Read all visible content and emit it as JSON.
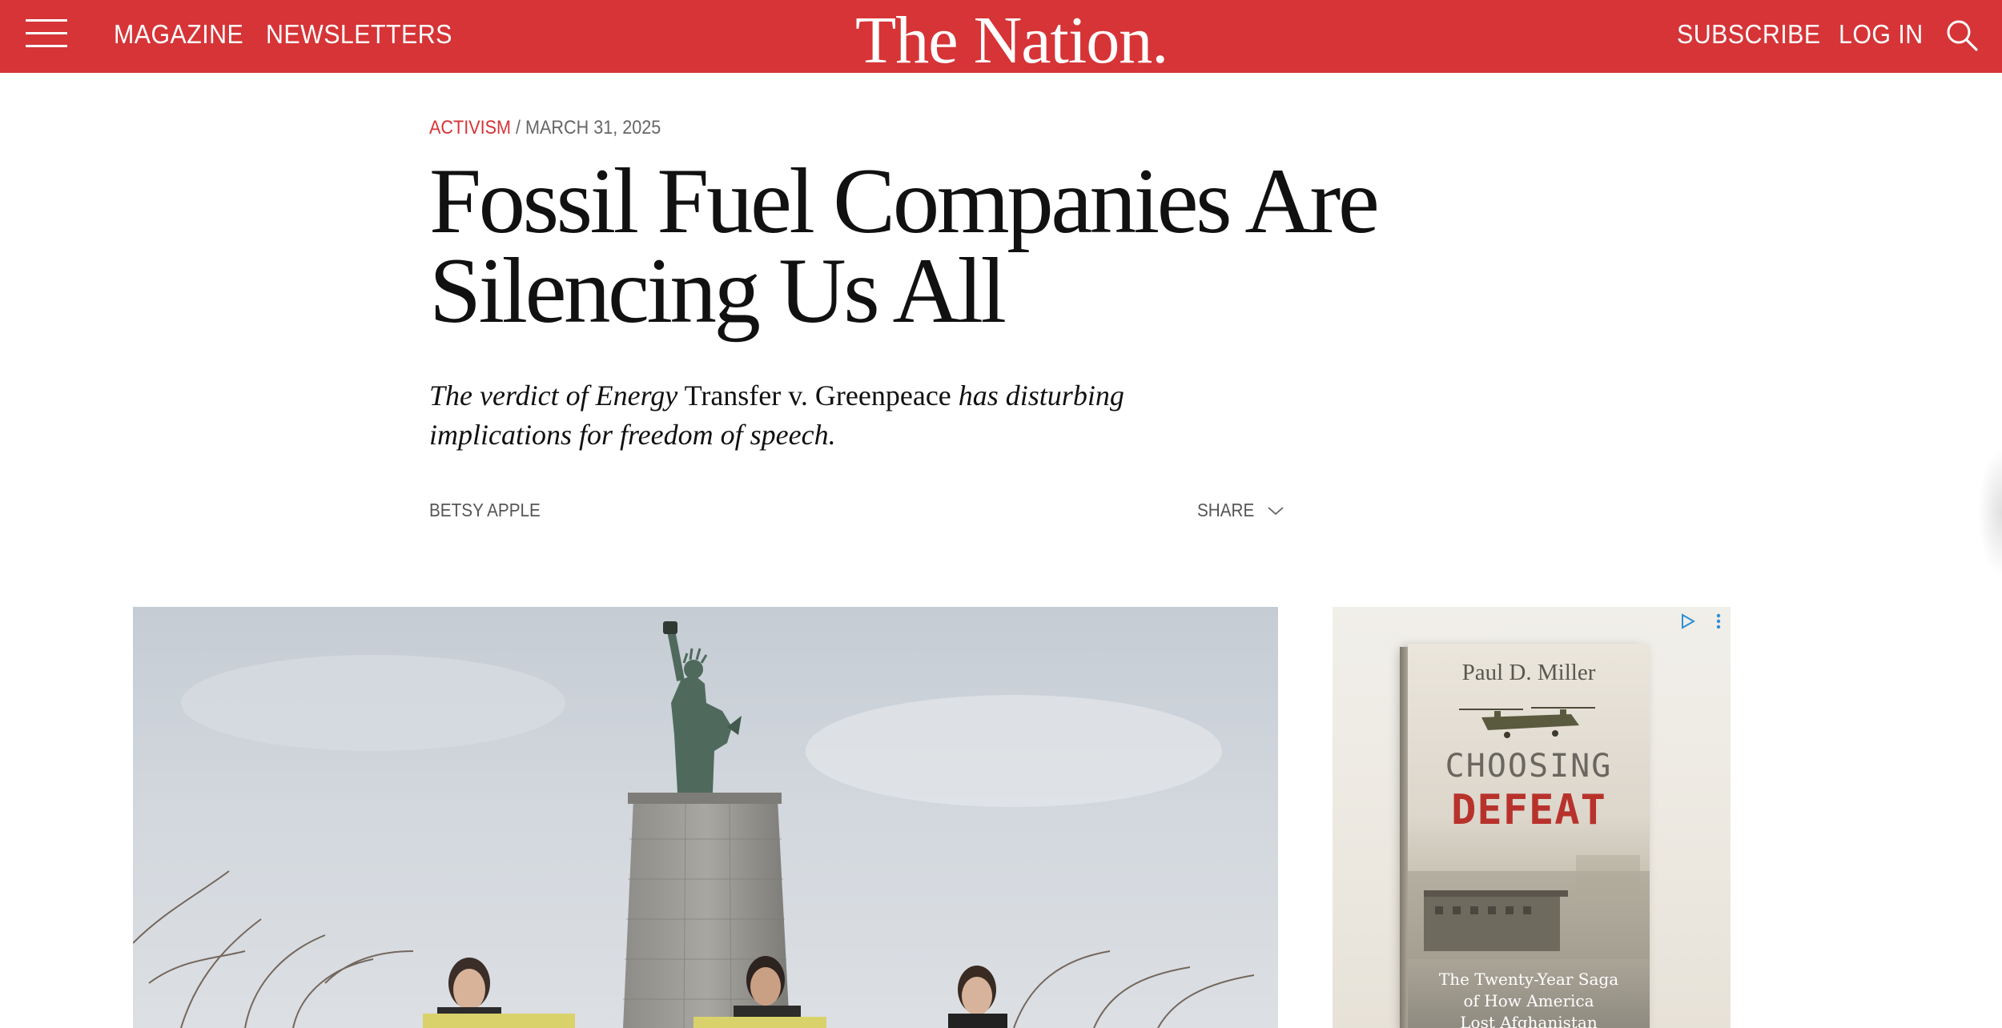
{
  "header": {
    "nav_left": [
      "MAGAZINE",
      "NEWSLETTERS"
    ],
    "logo": "The Nation.",
    "nav_right": [
      "SUBSCRIBE",
      "LOG IN"
    ],
    "background_color": "#d63437"
  },
  "article": {
    "category": "ACTIVISM",
    "separator": " / ",
    "date": "MARCH 31, 2025",
    "headline_line1": "Fossil Fuel Companies Are",
    "headline_line2": "Silencing Us All",
    "dek": {
      "part1": "The verdict of Energy",
      "part2": " Transfer v. Greenpeace ",
      "part3": "has disturbing implications for freedom of speech."
    },
    "author": "BETSY APPLE",
    "share_label": "SHARE"
  },
  "ad": {
    "author": "Paul D. Miller",
    "title_line1": "CHOOSING",
    "title_line2": "DEFEAT",
    "subtitle": "The Twenty-Year Saga\nof How America\nLost Afghanistan"
  }
}
